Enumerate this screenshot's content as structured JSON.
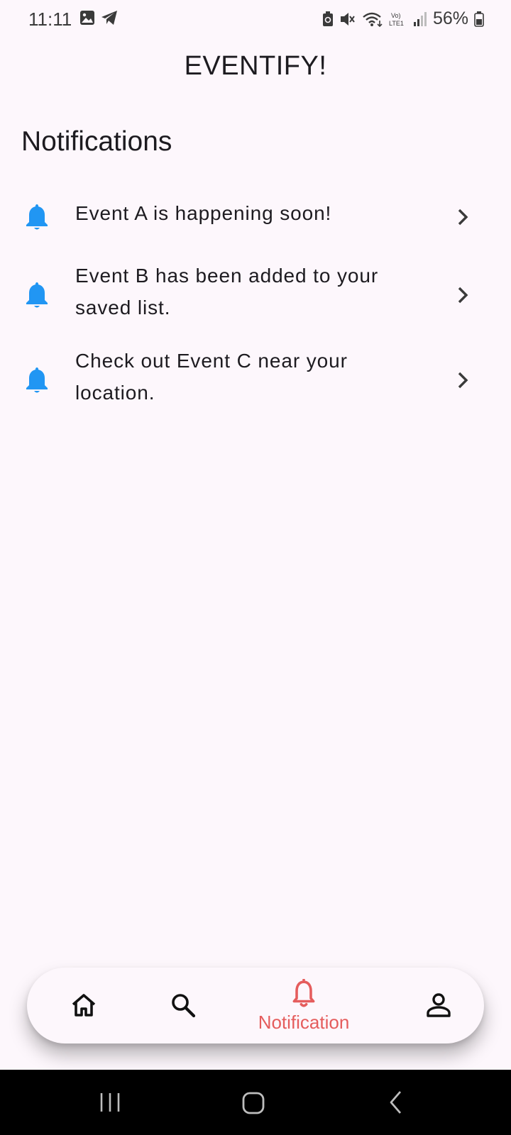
{
  "status_bar": {
    "time": "11:11",
    "battery": "56%",
    "network_label": "Vo) LTE1"
  },
  "app": {
    "title": "EVENTIFY!"
  },
  "section": {
    "title": "Notifications"
  },
  "notifications": [
    {
      "icon": "bell-icon",
      "text": "Event A is happening soon!"
    },
    {
      "icon": "bell-icon",
      "text": "Event B has been added to your saved list."
    },
    {
      "icon": "bell-icon",
      "text": "Check out Event C near your location."
    }
  ],
  "bottom_nav": {
    "items": [
      {
        "icon": "home-icon",
        "label": ""
      },
      {
        "icon": "search-icon",
        "label": ""
      },
      {
        "icon": "bell-icon",
        "label": "Notification",
        "active": true
      },
      {
        "icon": "person-icon",
        "label": ""
      }
    ]
  },
  "colors": {
    "background": "#fdf7fc",
    "bell_blue": "#2196f3",
    "active_red": "#e55d5d",
    "text": "#1d1b20"
  }
}
